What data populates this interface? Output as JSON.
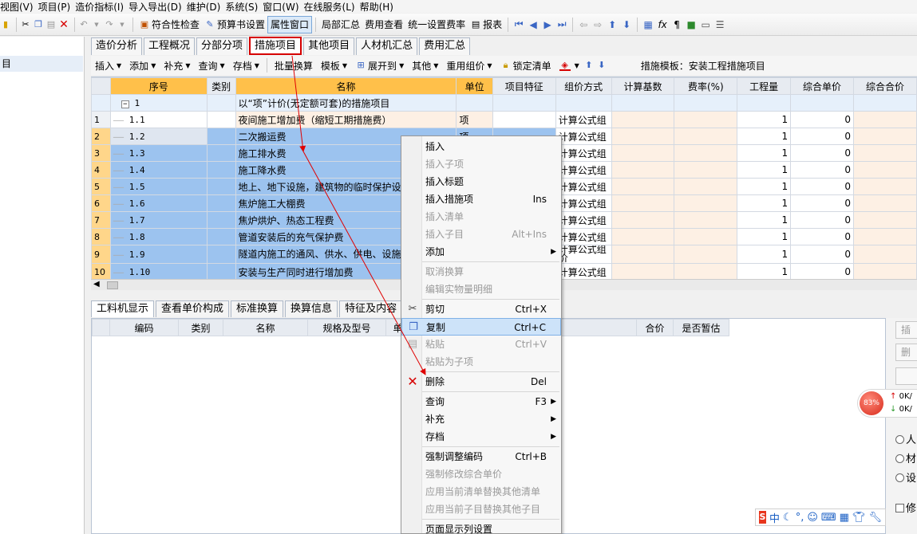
{
  "menubar": [
    "视图(V)",
    "项目(P)",
    "造价指标(I)",
    "导入导出(D)",
    "维护(D)",
    "系统(S)",
    "窗口(W)",
    "在线服务(L)",
    "帮助(H)"
  ],
  "toolbar": {
    "check": "符合性检查",
    "budget": "预算书设置",
    "property": "属性窗口",
    "local_sum": "局部汇总",
    "fee_view": "费用查看",
    "unify_rate": "统一设置费率",
    "report": "报表"
  },
  "tabs": [
    "造价分析",
    "工程概况",
    "分部分项",
    "措施项目",
    "其他项目",
    "人材机汇总",
    "费用汇总"
  ],
  "active_tab": "措施项目",
  "subtoolbar": {
    "items": [
      "插入",
      "添加",
      "补充",
      "查询",
      "存档"
    ],
    "batch": "批量换算",
    "template": "模板",
    "expand": "展开到",
    "other": "其他",
    "reuse": "重用组价",
    "lock": "锁定清单",
    "template_label": "措施模板：安装工程措施项目"
  },
  "grid": {
    "headers": [
      "序号",
      "类别",
      "名称",
      "单位",
      "项目特征",
      "组价方式",
      "计算基数",
      "费率(%)",
      "工程量",
      "综合单价",
      "综合合价"
    ],
    "group_row": {
      "code": "1",
      "name": "以“项”计价(无定额可套)的措施项目"
    },
    "rows": [
      {
        "rn": "1",
        "code": "1.1",
        "name": "夜间施工增加费（缩短工期措施费）",
        "unit": "项",
        "method": "计算公式组",
        "qty": "1",
        "price": "0"
      },
      {
        "rn": "2",
        "code": "1.2",
        "name": "二次搬运费",
        "unit": "项",
        "method": "计算公式组",
        "qty": "1",
        "price": "0"
      },
      {
        "rn": "3",
        "code": "1.3",
        "name": "施工排水费",
        "unit": "",
        "method": "计算公式组",
        "qty": "1",
        "price": "0"
      },
      {
        "rn": "4",
        "code": "1.4",
        "name": "施工降水费",
        "unit": "",
        "method": "计算公式组",
        "qty": "1",
        "price": "0"
      },
      {
        "rn": "5",
        "code": "1.5",
        "name": "地上、地下设施，建筑物的临时保护设",
        "unit": "",
        "method": "计算公式组",
        "qty": "1",
        "price": "0"
      },
      {
        "rn": "6",
        "code": "1.6",
        "name": "焦炉施工大棚费",
        "unit": "",
        "method": "计算公式组",
        "qty": "1",
        "price": "0"
      },
      {
        "rn": "7",
        "code": "1.7",
        "name": "焦炉烘炉、热态工程费",
        "unit": "",
        "method": "计算公式组",
        "qty": "1",
        "price": "0"
      },
      {
        "rn": "8",
        "code": "1.8",
        "name": "管道安装后的充气保护费",
        "unit": "",
        "method": "计算公式组",
        "qty": "1",
        "price": "0"
      },
      {
        "rn": "9",
        "code": "1.9",
        "name": "隧道内施工的通风、供水、供电、设施增加费",
        "unit": "",
        "method": "计算公式组价",
        "qty": "1",
        "price": "0"
      },
      {
        "rn": "10",
        "code": "1.10",
        "name": "安装与生产同时进行增加费",
        "unit": "",
        "method": "计算公式组",
        "qty": "1",
        "price": "0"
      }
    ]
  },
  "lower_tabs": [
    "工料机显示",
    "查看单价构成",
    "标准换算",
    "换算信息",
    "特征及内容"
  ],
  "lower_grid_headers": [
    "编码",
    "类别",
    "名称",
    "规格及型号",
    "单位",
    "合价",
    "是否暂估"
  ],
  "right_panel": {
    "buttons": [
      "插",
      "删"
    ],
    "radios": [
      "人",
      "材",
      "设"
    ],
    "checkbox": "修"
  },
  "speed_widget": {
    "percent": "83%",
    "up": "0K/",
    "down": "0K/"
  },
  "ime_bar": {
    "mode": "中"
  },
  "context_menu": [
    {
      "label": "插入",
      "shortcut": "",
      "disabled": false
    },
    {
      "label": "插入子项",
      "shortcut": "",
      "disabled": true
    },
    {
      "label": "插入标题",
      "shortcut": "",
      "disabled": false
    },
    {
      "label": "插入措施项",
      "shortcut": "Ins",
      "disabled": false
    },
    {
      "label": "插入清单",
      "shortcut": "",
      "disabled": true
    },
    {
      "label": "插入子目",
      "shortcut": "Alt+Ins",
      "disabled": true
    },
    {
      "label": "添加",
      "shortcut": "",
      "disabled": false,
      "submenu": true
    },
    {
      "label": "取消换算",
      "shortcut": "",
      "disabled": true
    },
    {
      "label": "编辑实物量明细",
      "shortcut": "",
      "disabled": true
    },
    {
      "label": "剪切",
      "shortcut": "Ctrl+X",
      "disabled": false
    },
    {
      "label": "复制",
      "shortcut": "Ctrl+C",
      "disabled": false,
      "highlighted": true
    },
    {
      "label": "粘贴",
      "shortcut": "Ctrl+V",
      "disabled": true
    },
    {
      "label": "粘贴为子项",
      "shortcut": "",
      "disabled": true
    },
    {
      "label": "删除",
      "shortcut": "Del",
      "disabled": false
    },
    {
      "label": "查询",
      "shortcut": "F3",
      "disabled": false,
      "submenu": true
    },
    {
      "label": "补充",
      "shortcut": "",
      "disabled": false,
      "submenu": true
    },
    {
      "label": "存档",
      "shortcut": "",
      "disabled": false,
      "submenu": true
    },
    {
      "label": "强制调整编码",
      "shortcut": "Ctrl+B",
      "disabled": false
    },
    {
      "label": "强制修改综合单价",
      "shortcut": "",
      "disabled": true
    },
    {
      "label": "应用当前清单替换其他清单",
      "shortcut": "",
      "disabled": true
    },
    {
      "label": "应用当前子目替换其他子目",
      "shortcut": "",
      "disabled": true
    },
    {
      "label": "页面显示列设置",
      "shortcut": "",
      "disabled": false
    }
  ],
  "colors": {
    "accent_red": "#d60000",
    "selection_blue": "#9cc3ef",
    "header_orange": "#ffc04a"
  }
}
